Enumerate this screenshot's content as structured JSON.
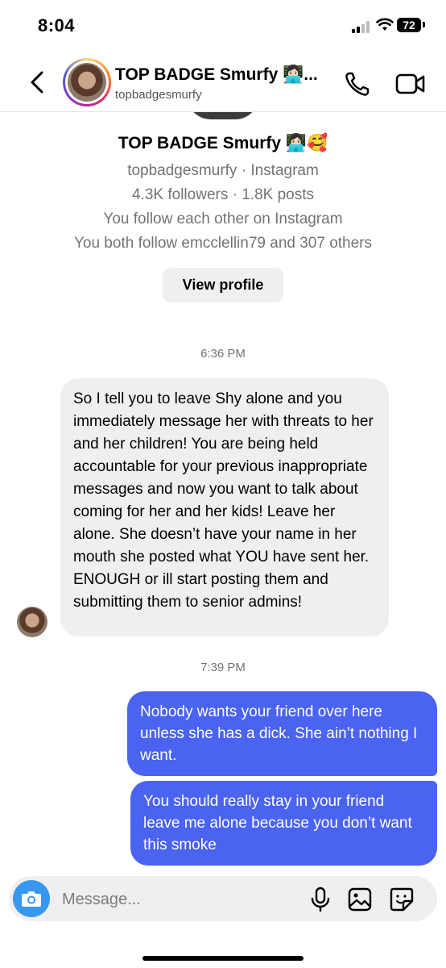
{
  "status_bar": {
    "time": "8:04",
    "battery": "72"
  },
  "header": {
    "name": "TOP BADGE Smurfy 👩🏻‍💻...",
    "handle": "topbadgesmurfy"
  },
  "profile": {
    "name": "TOP BADGE Smurfy 👩🏻‍💻🥰",
    "platform_line": "topbadgesmurfy · Instagram",
    "stats_line": "4.3K followers · 1.8K posts",
    "follow_line": "You follow each other on Instagram",
    "mutual_line": "You both follow emcclellin79 and 307 others",
    "view_profile_label": "View profile"
  },
  "messages": {
    "timestamp_1": "6:36 PM",
    "incoming_1": "So I tell you to leave Shy alone and you immediately message her with threats to her and her children! You are being held accountable for your previous inappropriate messages and now you want to talk about coming for her and her kids! Leave her alone. She doesn’t have your name in her mouth she posted what YOU have sent her. ENOUGH or ill start posting them and submitting them to senior admins!",
    "timestamp_2": "7:39 PM",
    "outgoing_1": "Nobody wants your friend over here unless she has a dick. She ain’t nothing I want.",
    "outgoing_2": "You should really stay in your friend leave me alone because you don’t want this smoke"
  },
  "composer": {
    "placeholder": "Message..."
  },
  "colors": {
    "accent_blue": "#3897f0",
    "outgoing_bubble": "#4a63f0",
    "incoming_bubble": "#efefef"
  },
  "icons": [
    "back-icon",
    "phone-icon",
    "video-camera-icon",
    "camera-icon",
    "microphone-icon",
    "gallery-icon",
    "sticker-icon",
    "wifi-icon",
    "signal-icon",
    "battery-icon"
  ]
}
